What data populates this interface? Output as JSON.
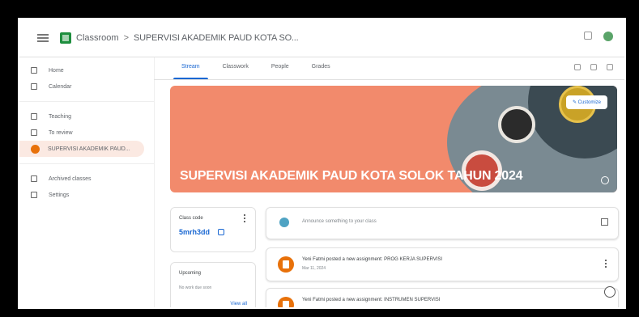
{
  "topbar": {
    "brand": "Classroom",
    "separator": ">",
    "breadcrumb": "SUPERVISI AKADEMIK PAUD KOTA SO..."
  },
  "sidebar": {
    "items": [
      {
        "label": "Home",
        "icon": "home-icon"
      },
      {
        "label": "Calendar",
        "icon": "calendar-icon"
      },
      {
        "label": "Teaching",
        "icon": "people-icon"
      },
      {
        "label": "To review",
        "icon": "folder-icon"
      },
      {
        "label": "SUPERVISI AKADEMIK PAUD...",
        "icon": "class-avatar-icon"
      },
      {
        "label": "Archived classes",
        "icon": "archive-icon"
      },
      {
        "label": "Settings",
        "icon": "gear-icon"
      }
    ]
  },
  "tabs": [
    "Stream",
    "Classwork",
    "People",
    "Grades"
  ],
  "banner": {
    "title": "SUPERVISI AKADEMIK PAUD KOTA SOLOK TAHUN 2024",
    "customize_label": "Customize",
    "accent": "#f28a6c"
  },
  "class_code": {
    "label": "Class code",
    "value": "5mrh3dd"
  },
  "upcoming": {
    "title": "Upcoming",
    "subtitle": "No work due soon",
    "view_all": "View all"
  },
  "announce": {
    "placeholder": "Announce something to your class"
  },
  "posts": [
    {
      "title": "Yeni Fatmi posted a new assignment: PROG KERJA SUPERVISI",
      "date": "Mar 11, 2024"
    },
    {
      "title": "Yeni Fatmi posted a new assignment: INSTRUMEN SUPERVISI",
      "date": ""
    }
  ],
  "colors": {
    "primary": "#1967d2",
    "class": "#e8710a",
    "brand": "#1e8e3e"
  }
}
